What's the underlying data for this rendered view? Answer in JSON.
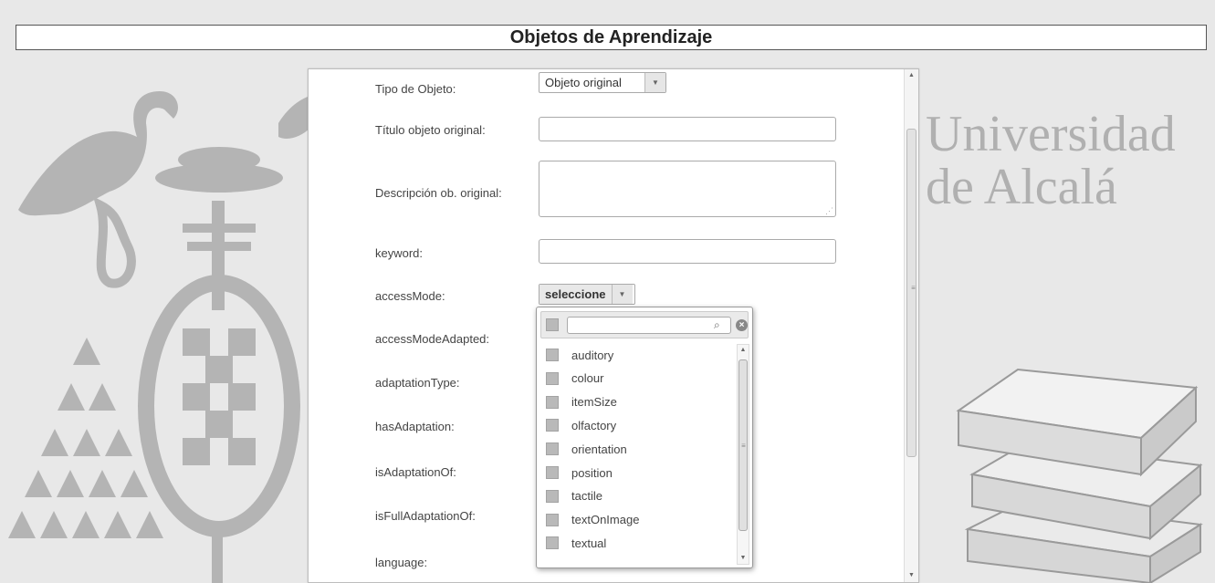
{
  "header": {
    "title": "Objetos de Aprendizaje"
  },
  "brand": {
    "line1": "Universidad",
    "line2": "de Alcalá"
  },
  "form": {
    "tipo_objeto": {
      "label": "Tipo de Objeto:",
      "value": "Objeto original"
    },
    "titulo": {
      "label": "Título objeto original:",
      "value": ""
    },
    "descripcion": {
      "label": "Descripción ob. original:",
      "value": ""
    },
    "keyword": {
      "label": "keyword:",
      "value": ""
    },
    "access_mode": {
      "label": "accessMode:",
      "value": "seleccione"
    },
    "access_mode_adapted": {
      "label": "accessModeAdapted:"
    },
    "adaptation_type": {
      "label": "adaptationType:"
    },
    "has_adaptation": {
      "label": "hasAdaptation:"
    },
    "is_adaptation_of": {
      "label": "isAdaptationOf:"
    },
    "is_full_adaptation_of": {
      "label": "isFullAdaptationOf:"
    },
    "language": {
      "label": "language:"
    }
  },
  "dropdown": {
    "search_value": "",
    "options": [
      "auditory",
      "colour",
      "itemSize",
      "olfactory",
      "orientation",
      "position",
      "tactile",
      "textOnImage",
      "textual"
    ]
  },
  "colors": {
    "page_bg": "#e8e8e8",
    "decor_gray": "#b0b0b0",
    "checkbox": "#b9b9b9"
  }
}
